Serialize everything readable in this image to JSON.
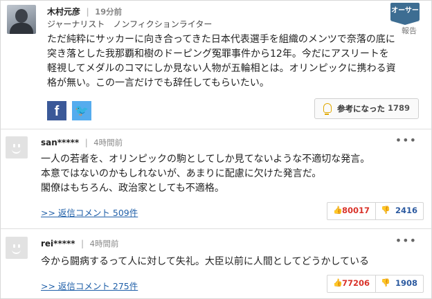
{
  "author": {
    "name": "木村元彦",
    "time": "19分前",
    "title": "ジャーナリスト　ノンフィクションライター",
    "badge": "オーサー",
    "report": "報告",
    "comment": "ただ純粋にサッカーに向き合ってきた日本代表選手を組織のメンツで奈落の底に\n突き落とした我那覇和樹のドーピング冤罪事件から12年。今だにアスリートを\n軽視してメダルのコマにしか見ない人物が五輪相とは。オリンピックに携わる資\n格が無い。この一言だけでも辞任してもらいたい。",
    "helpful_label": "参考になった",
    "helpful_count": "1789",
    "facebook_glyph": "f",
    "twitter_glyph": "🐦"
  },
  "replies": [
    {
      "user": "san*****",
      "time": "4時間前",
      "comment": "一人の若者を、オリンピックの駒としてしか見てないような不適切な発言。\n本意ではないのかもしれないが、あまりに配慮に欠けた発言だ。\n閣僚はもちろん、政治家としても不適格。",
      "reply_link": ">> 返信コメント 509件",
      "up": "80017",
      "down": "2416"
    },
    {
      "user": "rei*****",
      "time": "4時間前",
      "comment": "今から闘病するって人に対して失礼。大臣以前に人間としてどうかしている",
      "reply_link": ">> 返信コメント 275件",
      "up": "77206",
      "down": "1908"
    }
  ],
  "icons": {
    "more": "more-dots-icon",
    "thumb_up": "thumbs-up-icon",
    "thumb_down": "thumbs-down-icon",
    "bulb": "lightbulb-icon"
  }
}
